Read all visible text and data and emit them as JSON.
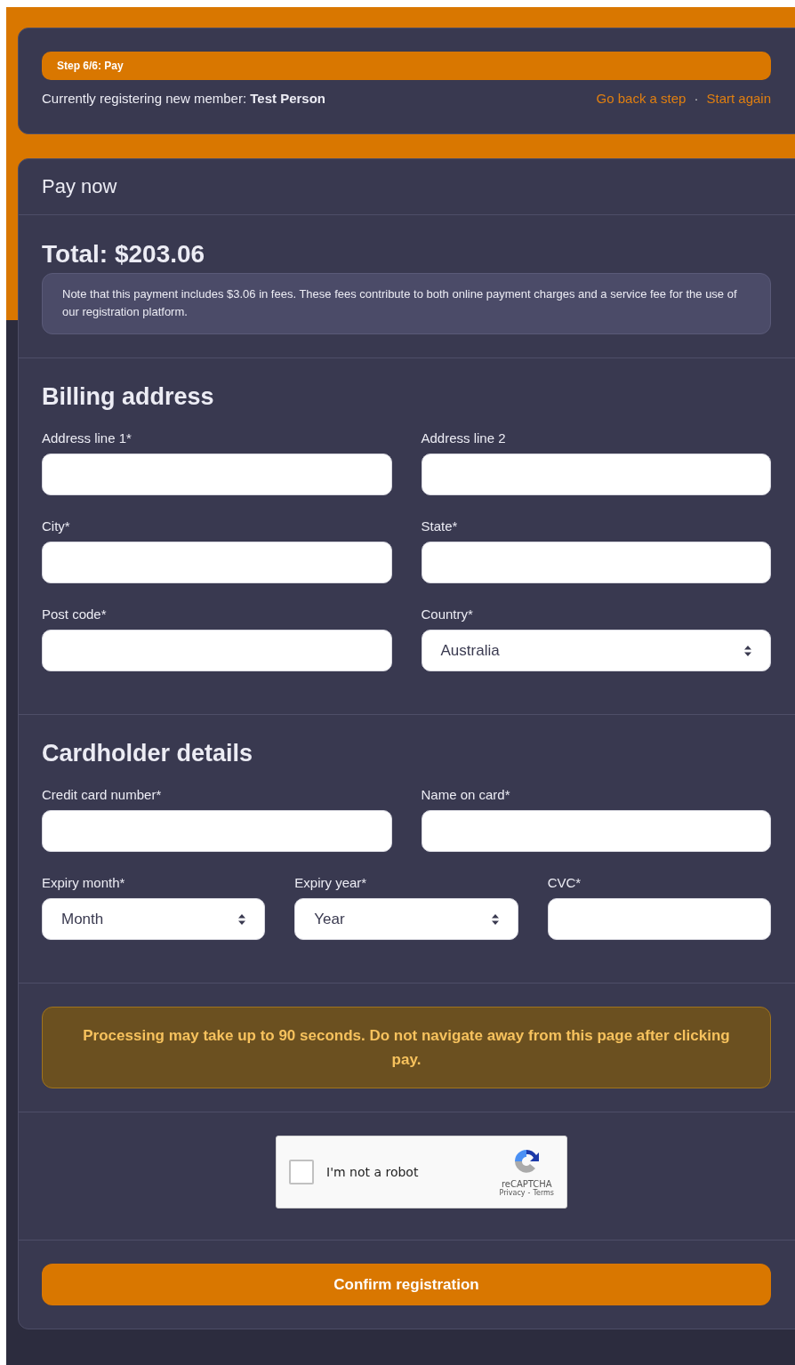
{
  "step": {
    "label": "Step 6/6: Pay"
  },
  "member": {
    "text": "Currently registering new member: **Test Person**"
  },
  "nav_links": [
    {
      "label": "Go back a step"
    },
    {
      "label": "Start again"
    }
  ],
  "separator": "·",
  "panel": {
    "title": "Pay now",
    "total": "Total: $203.06",
    "note": "Note that this payment includes $3.06 in fees. These fees contribute to both online payment charges and a service fee for the use of our registration platform."
  },
  "sections": [
    {
      "title": "Billing address",
      "rows": [
        [
          {
            "label": "Address line 1*",
            "kind": "text"
          },
          {
            "label": "Address line 2",
            "kind": "text"
          }
        ],
        [
          {
            "label": "City*",
            "kind": "text"
          },
          {
            "label": "State*",
            "kind": "text"
          }
        ],
        [
          {
            "label": "Post code*",
            "kind": "text"
          },
          {
            "label": "Country*",
            "kind": "select",
            "value": "Australia"
          }
        ]
      ]
    },
    {
      "title": "Cardholder details",
      "rows": [
        [
          {
            "label": "Credit card number*",
            "kind": "text"
          },
          {
            "label": "Name on card*",
            "kind": "text"
          }
        ],
        [
          {
            "label": "Expiry month*",
            "kind": "select",
            "value": "Month"
          },
          {
            "label": "Expiry year*",
            "kind": "select",
            "value": "Year"
          },
          {
            "label": "CVC*",
            "kind": "text"
          }
        ]
      ]
    }
  ],
  "warning": "Processing may take up to 90 seconds. Do not navigate away from this page after clicking pay.",
  "captcha": {
    "label": "I'm not a robot",
    "checked": false,
    "brand": "reCAPTCHA",
    "privacy": "Privacy",
    "dash": "-",
    "terms": "Terms"
  },
  "submit": "Confirm registration"
}
